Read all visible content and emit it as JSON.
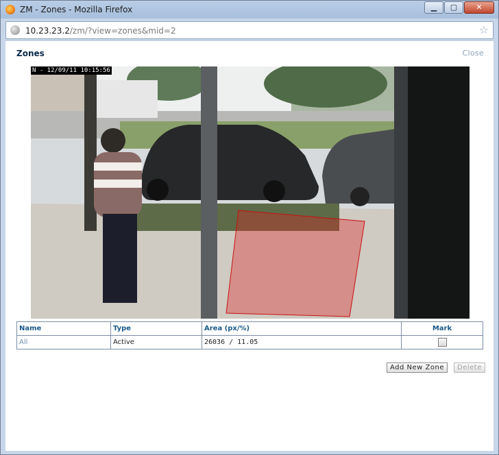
{
  "window": {
    "title": "ZM - Zones - Mozilla Firefox",
    "minimize_glyph": "▁",
    "maximize_glyph": "▢",
    "close_glyph": "✕"
  },
  "urlbar": {
    "host": "10.23.23.2",
    "path": "/zm/?view=zones&mid=2"
  },
  "page": {
    "title": "Zones",
    "close_label": "Close"
  },
  "camera": {
    "timestamp": "N - 12/09/11 10:15:56",
    "zone_color": "#e02020"
  },
  "table": {
    "headers": {
      "name": "Name",
      "type": "Type",
      "area": "Area (px/%)",
      "mark": "Mark"
    },
    "rows": [
      {
        "name": "All",
        "type": "Active",
        "area": "26036 / 11.05",
        "mark": false
      }
    ]
  },
  "buttons": {
    "add_new_zone": "Add New Zone",
    "delete": "Delete"
  }
}
